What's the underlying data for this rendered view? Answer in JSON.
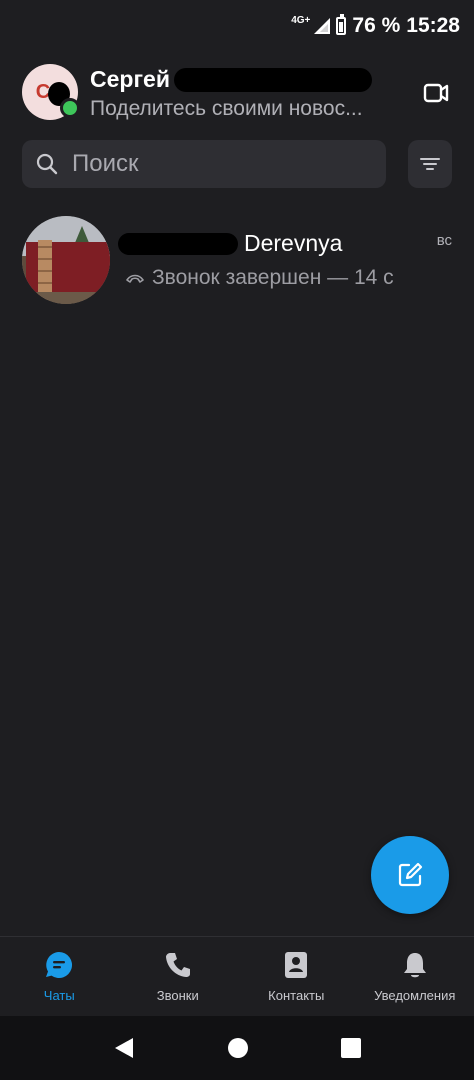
{
  "status_bar": {
    "network": "4G+",
    "battery": "76 %",
    "time": "15:28"
  },
  "profile": {
    "initials": "С",
    "name": "Сергей",
    "status_message": "Поделитесь своими новос...",
    "online": true
  },
  "search": {
    "placeholder": "Поиск"
  },
  "chats": [
    {
      "name": "Derevnya",
      "time": "вс",
      "preview": "Звонок завершен — 14 с",
      "preview_icon": "call-ended-icon"
    }
  ],
  "tabs": [
    {
      "label": "Чаты",
      "icon": "chat-icon",
      "active": true
    },
    {
      "label": "Звонки",
      "icon": "phone-icon",
      "active": false
    },
    {
      "label": "Контакты",
      "icon": "contacts-icon",
      "active": false
    },
    {
      "label": "Уведомления",
      "icon": "bell-icon",
      "active": false
    }
  ],
  "colors": {
    "accent": "#1a9be8",
    "background": "#1e1e21",
    "online": "#3ec65a"
  }
}
